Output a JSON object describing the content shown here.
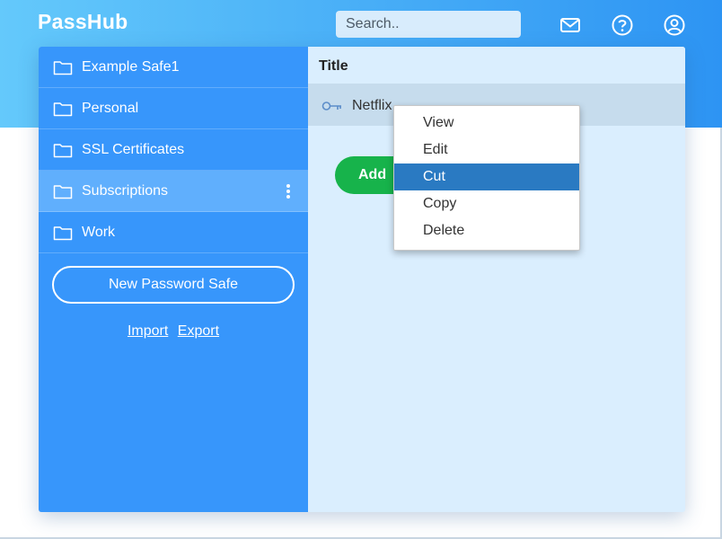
{
  "app": {
    "logo": "PassHub"
  },
  "header": {
    "search_placeholder": "Search..",
    "icons": [
      "mail-icon",
      "help-icon",
      "user-icon"
    ]
  },
  "sidebar": {
    "safes": [
      {
        "label": "Example Safe1"
      },
      {
        "label": "Personal"
      },
      {
        "label": "SSL Certificates"
      },
      {
        "label": "Subscriptions",
        "selected": true
      },
      {
        "label": "Work"
      }
    ],
    "new_safe_label": "New Password Safe",
    "import_label": "Import",
    "export_label": "Export"
  },
  "main": {
    "column_title": "Title",
    "items": [
      {
        "label": "Netflix",
        "icon": "key-icon"
      }
    ],
    "add_label": "Add"
  },
  "context_menu": {
    "items": [
      {
        "label": "View"
      },
      {
        "label": "Edit"
      },
      {
        "label": "Cut",
        "highlighted": true
      },
      {
        "label": "Copy"
      },
      {
        "label": "Delete"
      }
    ]
  },
  "colors": {
    "header_gradient_start": "#64c9fb",
    "header_gradient_end": "#2d94f3",
    "sidebar": "#3796fb",
    "sidebar_selected": "#60affd",
    "main_bg": "#daeefe",
    "add_button": "#17b34b",
    "menu_highlight": "#2a7ac2"
  }
}
